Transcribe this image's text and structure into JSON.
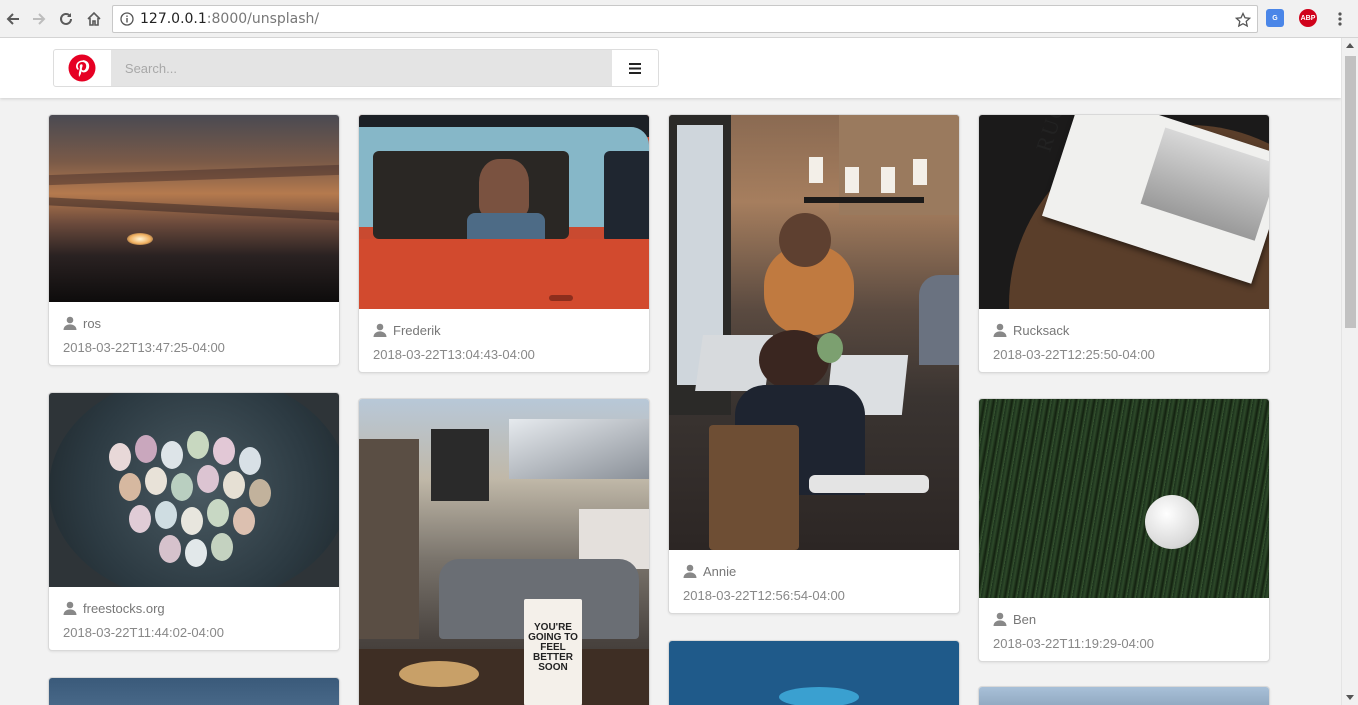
{
  "browser": {
    "url_host": "127.0.0.1",
    "url_path": ":8000/unsplash/"
  },
  "search": {
    "placeholder": "Search..."
  },
  "cards": [
    {
      "author": "ros",
      "date": "2018-03-22T13:47:25-04:00"
    },
    {
      "author": "Frederik",
      "date": "2018-03-22T13:04:43-04:00"
    },
    {
      "author": "Annie",
      "date": "2018-03-22T12:56:54-04:00"
    },
    {
      "author": "Rucksack",
      "date": "2018-03-22T12:25:50-04:00"
    },
    {
      "author": "freestocks.org",
      "date": "2018-03-22T11:44:02-04:00"
    },
    {
      "author": "Ben",
      "date": "2018-03-22T11:19:29-04:00"
    }
  ],
  "photo_text": {
    "rucksack": "RUCKSACK",
    "cup": "YOU'RE GOING TO FEEL BETTER SOON"
  },
  "colors": {
    "brand": "#e60023",
    "chrome_bg": "#f1f1f1",
    "page_bg": "#f2f2f2"
  }
}
